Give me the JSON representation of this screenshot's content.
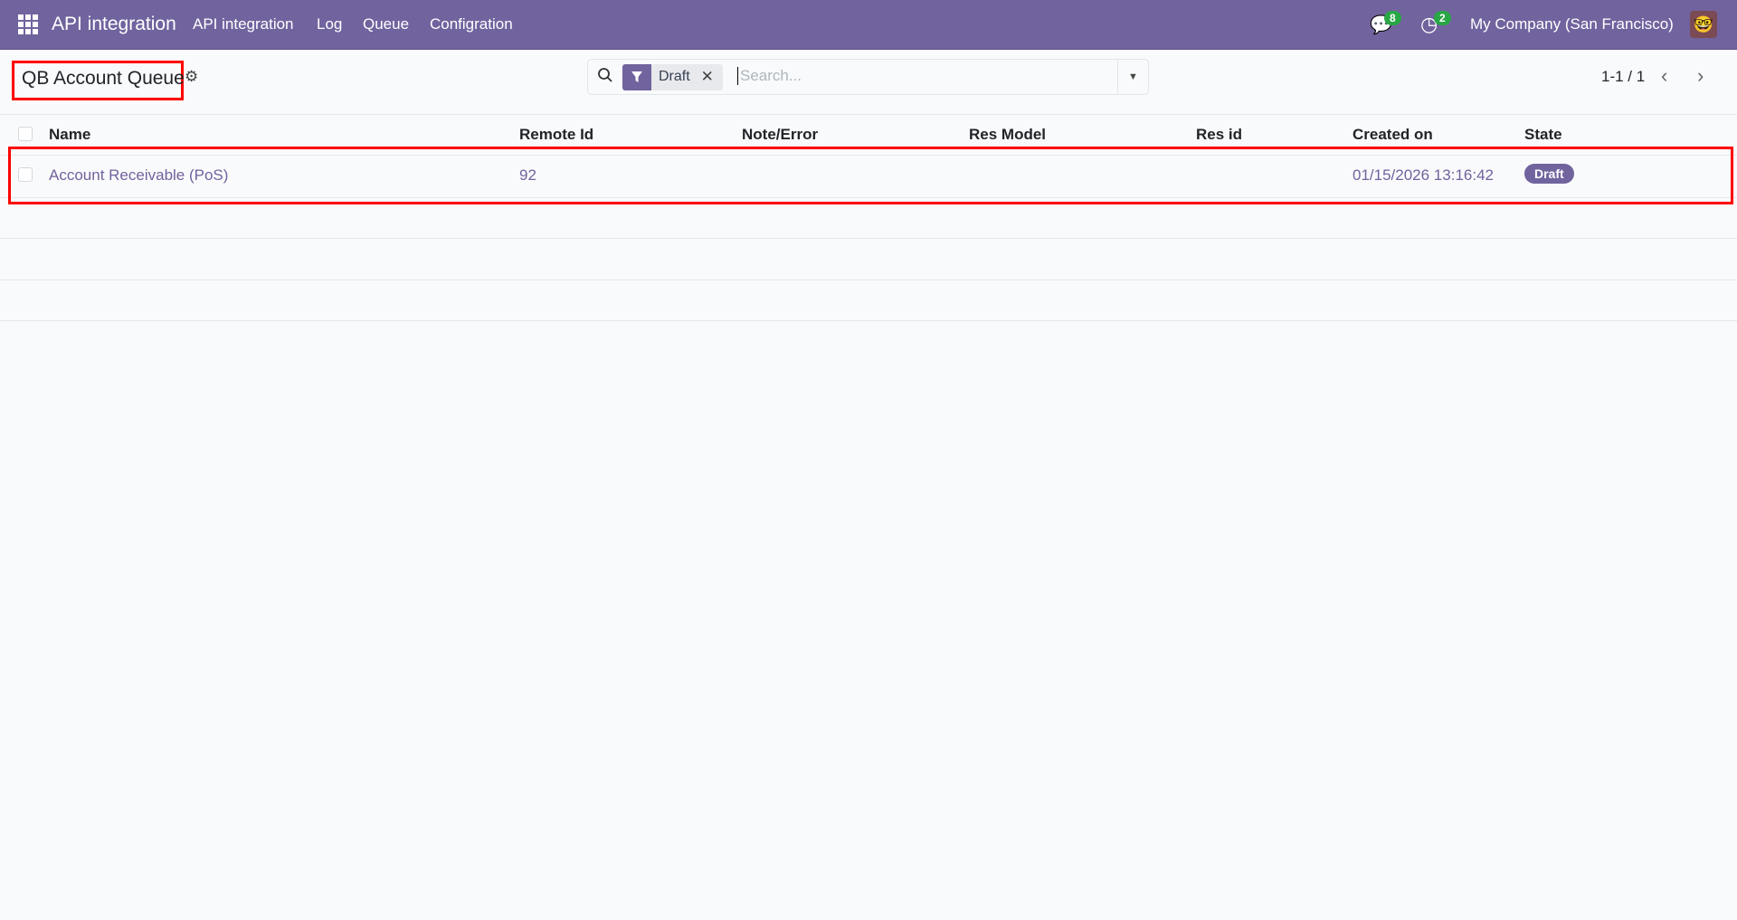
{
  "navbar": {
    "app_title": "API integration",
    "menu": [
      "API integration",
      "Log",
      "Queue",
      "Configration"
    ],
    "messages_count": "8",
    "activities_count": "2",
    "company": "My Company (San Francisco)"
  },
  "control_panel": {
    "title": "QB Account Queue",
    "facet_label": "Draft",
    "search_placeholder": "Search...",
    "pager": "1-1 / 1"
  },
  "table": {
    "columns": [
      "Name",
      "Remote Id",
      "Note/Error",
      "Res Model",
      "Res id",
      "Created on",
      "State"
    ],
    "rows": [
      {
        "name": "Account Receivable (PoS)",
        "remote_id": "92",
        "note": "",
        "res_model": "",
        "res_id": "",
        "created_on": "01/15/2026 13:16:42",
        "state": "Draft"
      }
    ]
  },
  "colors": {
    "brand": "#71639e",
    "badge": "#28a745",
    "highlight": "#ff0000"
  }
}
